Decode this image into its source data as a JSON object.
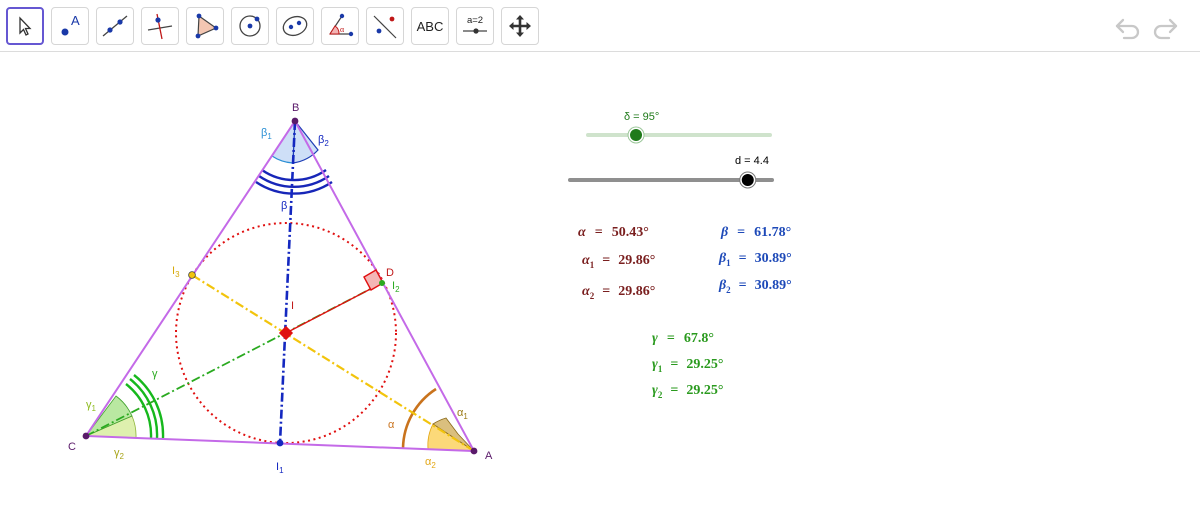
{
  "toolbar": {
    "text_tool_label": "ABC",
    "slider_tool_label": "a=2"
  },
  "sliders": {
    "delta": {
      "label": "δ = 95°",
      "value": 95,
      "min": 0,
      "max": 360
    },
    "d": {
      "label": "d = 4.4",
      "value": 4.4,
      "min": 0,
      "max": 5
    }
  },
  "points": {
    "A": "A",
    "B": "B",
    "C": "C",
    "D": "D",
    "I": "I",
    "I1": "I",
    "I1_sub": "1",
    "I2": "I",
    "I2_sub": "2",
    "I3": "I",
    "I3_sub": "3"
  },
  "angles": {
    "alpha": "α",
    "alpha1": "α",
    "alpha1_sub": "1",
    "alpha2": "α",
    "alpha2_sub": "2",
    "beta": "β",
    "beta1": "β",
    "beta1_sub": "1",
    "beta2": "β",
    "beta2_sub": "2",
    "gamma": "γ",
    "gamma1": "γ",
    "gamma1_sub": "1",
    "gamma2": "γ",
    "gamma2_sub": "2"
  },
  "measurements": {
    "alpha": {
      "sym": "α",
      "sub": "",
      "value": "50.43°"
    },
    "alpha1": {
      "sym": "α",
      "sub": "1",
      "value": "29.86°"
    },
    "alpha2": {
      "sym": "α",
      "sub": "2",
      "value": "29.86°"
    },
    "beta": {
      "sym": "β",
      "sub": "",
      "value": "61.78°"
    },
    "beta1": {
      "sym": "β",
      "sub": "1",
      "value": "30.89°"
    },
    "beta2": {
      "sym": "β",
      "sub": "2",
      "value": "30.89°"
    },
    "gamma": {
      "sym": "γ",
      "sub": "",
      "value": "67.8°"
    },
    "gamma1": {
      "sym": "γ",
      "sub": "1",
      "value": "29.25°"
    },
    "gamma2": {
      "sym": "γ",
      "sub": "2",
      "value": "29.25°"
    },
    "equals": "="
  },
  "colors": {
    "triangle": "#c46ae8",
    "alpha": "#7a1f1f",
    "beta": "#1d49b8",
    "gamma": "#2a9a1e",
    "incircle": "#e01010",
    "toolbar_active": "#6557d2"
  }
}
